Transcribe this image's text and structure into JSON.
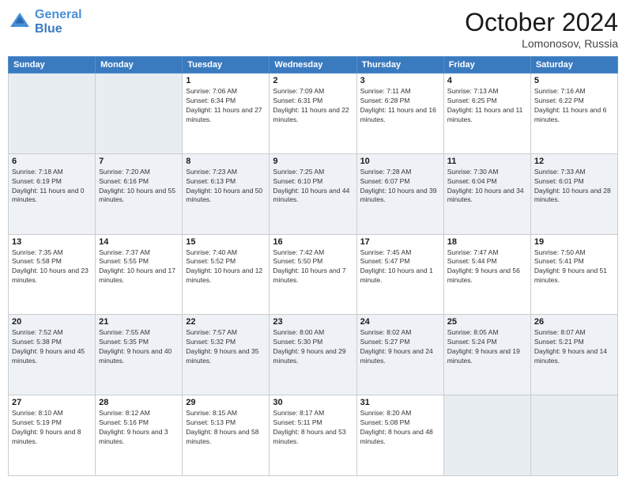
{
  "header": {
    "logo_line1": "General",
    "logo_line2": "Blue",
    "month": "October 2024",
    "location": "Lomonosov, Russia"
  },
  "days_of_week": [
    "Sunday",
    "Monday",
    "Tuesday",
    "Wednesday",
    "Thursday",
    "Friday",
    "Saturday"
  ],
  "weeks": [
    [
      {
        "num": "",
        "sunrise": "",
        "sunset": "",
        "daylight": "",
        "empty": true
      },
      {
        "num": "",
        "sunrise": "",
        "sunset": "",
        "daylight": "",
        "empty": true
      },
      {
        "num": "1",
        "sunrise": "Sunrise: 7:06 AM",
        "sunset": "Sunset: 6:34 PM",
        "daylight": "Daylight: 11 hours and 27 minutes."
      },
      {
        "num": "2",
        "sunrise": "Sunrise: 7:09 AM",
        "sunset": "Sunset: 6:31 PM",
        "daylight": "Daylight: 11 hours and 22 minutes."
      },
      {
        "num": "3",
        "sunrise": "Sunrise: 7:11 AM",
        "sunset": "Sunset: 6:28 PM",
        "daylight": "Daylight: 11 hours and 16 minutes."
      },
      {
        "num": "4",
        "sunrise": "Sunrise: 7:13 AM",
        "sunset": "Sunset: 6:25 PM",
        "daylight": "Daylight: 11 hours and 11 minutes."
      },
      {
        "num": "5",
        "sunrise": "Sunrise: 7:16 AM",
        "sunset": "Sunset: 6:22 PM",
        "daylight": "Daylight: 11 hours and 6 minutes."
      }
    ],
    [
      {
        "num": "6",
        "sunrise": "Sunrise: 7:18 AM",
        "sunset": "Sunset: 6:19 PM",
        "daylight": "Daylight: 11 hours and 0 minutes."
      },
      {
        "num": "7",
        "sunrise": "Sunrise: 7:20 AM",
        "sunset": "Sunset: 6:16 PM",
        "daylight": "Daylight: 10 hours and 55 minutes."
      },
      {
        "num": "8",
        "sunrise": "Sunrise: 7:23 AM",
        "sunset": "Sunset: 6:13 PM",
        "daylight": "Daylight: 10 hours and 50 minutes."
      },
      {
        "num": "9",
        "sunrise": "Sunrise: 7:25 AM",
        "sunset": "Sunset: 6:10 PM",
        "daylight": "Daylight: 10 hours and 44 minutes."
      },
      {
        "num": "10",
        "sunrise": "Sunrise: 7:28 AM",
        "sunset": "Sunset: 6:07 PM",
        "daylight": "Daylight: 10 hours and 39 minutes."
      },
      {
        "num": "11",
        "sunrise": "Sunrise: 7:30 AM",
        "sunset": "Sunset: 6:04 PM",
        "daylight": "Daylight: 10 hours and 34 minutes."
      },
      {
        "num": "12",
        "sunrise": "Sunrise: 7:33 AM",
        "sunset": "Sunset: 6:01 PM",
        "daylight": "Daylight: 10 hours and 28 minutes."
      }
    ],
    [
      {
        "num": "13",
        "sunrise": "Sunrise: 7:35 AM",
        "sunset": "Sunset: 5:58 PM",
        "daylight": "Daylight: 10 hours and 23 minutes."
      },
      {
        "num": "14",
        "sunrise": "Sunrise: 7:37 AM",
        "sunset": "Sunset: 5:55 PM",
        "daylight": "Daylight: 10 hours and 17 minutes."
      },
      {
        "num": "15",
        "sunrise": "Sunrise: 7:40 AM",
        "sunset": "Sunset: 5:52 PM",
        "daylight": "Daylight: 10 hours and 12 minutes."
      },
      {
        "num": "16",
        "sunrise": "Sunrise: 7:42 AM",
        "sunset": "Sunset: 5:50 PM",
        "daylight": "Daylight: 10 hours and 7 minutes."
      },
      {
        "num": "17",
        "sunrise": "Sunrise: 7:45 AM",
        "sunset": "Sunset: 5:47 PM",
        "daylight": "Daylight: 10 hours and 1 minute."
      },
      {
        "num": "18",
        "sunrise": "Sunrise: 7:47 AM",
        "sunset": "Sunset: 5:44 PM",
        "daylight": "Daylight: 9 hours and 56 minutes."
      },
      {
        "num": "19",
        "sunrise": "Sunrise: 7:50 AM",
        "sunset": "Sunset: 5:41 PM",
        "daylight": "Daylight: 9 hours and 51 minutes."
      }
    ],
    [
      {
        "num": "20",
        "sunrise": "Sunrise: 7:52 AM",
        "sunset": "Sunset: 5:38 PM",
        "daylight": "Daylight: 9 hours and 45 minutes."
      },
      {
        "num": "21",
        "sunrise": "Sunrise: 7:55 AM",
        "sunset": "Sunset: 5:35 PM",
        "daylight": "Daylight: 9 hours and 40 minutes."
      },
      {
        "num": "22",
        "sunrise": "Sunrise: 7:57 AM",
        "sunset": "Sunset: 5:32 PM",
        "daylight": "Daylight: 9 hours and 35 minutes."
      },
      {
        "num": "23",
        "sunrise": "Sunrise: 8:00 AM",
        "sunset": "Sunset: 5:30 PM",
        "daylight": "Daylight: 9 hours and 29 minutes."
      },
      {
        "num": "24",
        "sunrise": "Sunrise: 8:02 AM",
        "sunset": "Sunset: 5:27 PM",
        "daylight": "Daylight: 9 hours and 24 minutes."
      },
      {
        "num": "25",
        "sunrise": "Sunrise: 8:05 AM",
        "sunset": "Sunset: 5:24 PM",
        "daylight": "Daylight: 9 hours and 19 minutes."
      },
      {
        "num": "26",
        "sunrise": "Sunrise: 8:07 AM",
        "sunset": "Sunset: 5:21 PM",
        "daylight": "Daylight: 9 hours and 14 minutes."
      }
    ],
    [
      {
        "num": "27",
        "sunrise": "Sunrise: 8:10 AM",
        "sunset": "Sunset: 5:19 PM",
        "daylight": "Daylight: 9 hours and 8 minutes."
      },
      {
        "num": "28",
        "sunrise": "Sunrise: 8:12 AM",
        "sunset": "Sunset: 5:16 PM",
        "daylight": "Daylight: 9 hours and 3 minutes."
      },
      {
        "num": "29",
        "sunrise": "Sunrise: 8:15 AM",
        "sunset": "Sunset: 5:13 PM",
        "daylight": "Daylight: 8 hours and 58 minutes."
      },
      {
        "num": "30",
        "sunrise": "Sunrise: 8:17 AM",
        "sunset": "Sunset: 5:11 PM",
        "daylight": "Daylight: 8 hours and 53 minutes."
      },
      {
        "num": "31",
        "sunrise": "Sunrise: 8:20 AM",
        "sunset": "Sunset: 5:08 PM",
        "daylight": "Daylight: 8 hours and 48 minutes."
      },
      {
        "num": "",
        "sunrise": "",
        "sunset": "",
        "daylight": "",
        "empty": true
      },
      {
        "num": "",
        "sunrise": "",
        "sunset": "",
        "daylight": "",
        "empty": true
      }
    ]
  ]
}
